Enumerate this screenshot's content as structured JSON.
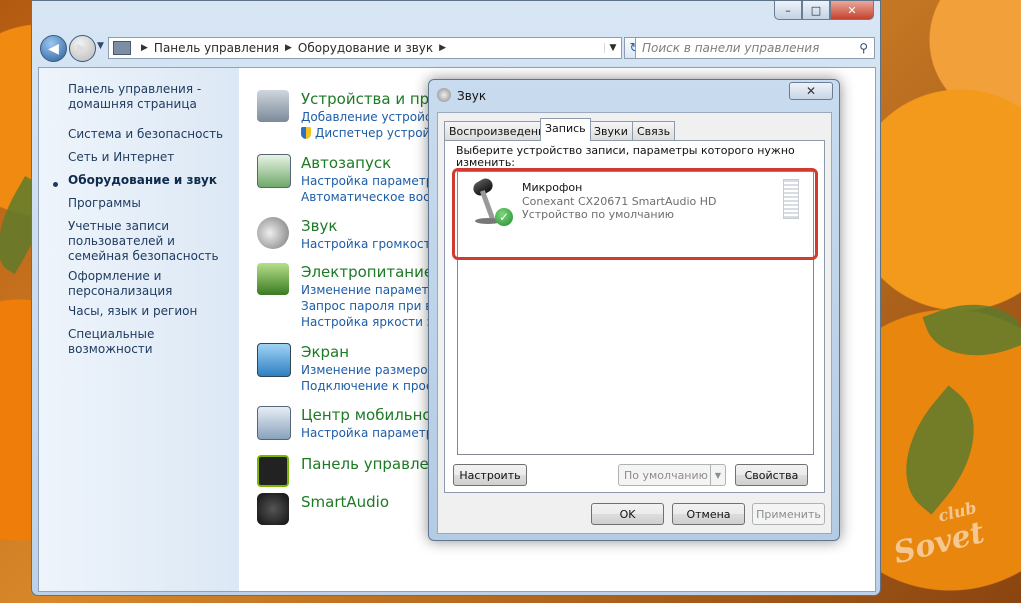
{
  "window": {
    "controls": {
      "minimize": "–",
      "maximize": "□",
      "close": "✕"
    }
  },
  "address": {
    "crumbs": [
      "Панель управления",
      "Оборудование и звук"
    ],
    "search_placeholder": "Поиск в панели управления"
  },
  "left_pane": {
    "items": [
      "Панель управления - домашняя страница",
      "Система и безопасность",
      "Сеть и Интернет",
      "Оборудование и звук",
      "Программы",
      "Учетные записи пользователей и семейная безопасность",
      "Оформление и персонализация",
      "Часы, язык и регион",
      "Специальные возможности"
    ],
    "active_index": 3
  },
  "categories": [
    {
      "title": "Устройства и принтеры",
      "icon": "devices-printers-icon",
      "links": [
        "Добавление устройства",
        "Диспетчер устройств"
      ]
    },
    {
      "title": "Автозапуск",
      "icon": "autoplay-icon",
      "links": [
        "Настройка параметров",
        "Автоматическое воспроизведение"
      ]
    },
    {
      "title": "Звук",
      "icon": "speaker-icon",
      "links": [
        "Настройка громкости"
      ]
    },
    {
      "title": "Электропитание",
      "icon": "power-options-icon",
      "links": [
        "Изменение параметров",
        "Запрос пароля при выходе",
        "Настройка яркости экрана"
      ]
    },
    {
      "title": "Экран",
      "icon": "display-icon",
      "links": [
        "Изменение размеров текста",
        "Подключение к проектору"
      ]
    },
    {
      "title": "Центр мобильности",
      "icon": "mobility-center-icon",
      "links": [
        "Настройка параметров"
      ]
    },
    {
      "title": "Панель управления",
      "icon": "nvidia-icon",
      "links": []
    },
    {
      "title": "SmartAudio",
      "icon": "smartaudio-icon",
      "links": []
    }
  ],
  "dialog": {
    "title": "Звук",
    "close": "✕",
    "tabs": [
      "Воспроизведение",
      "Запись",
      "Звуки",
      "Связь"
    ],
    "selected_tab": 1,
    "instruction": "Выберите устройство записи, параметры которого нужно изменить:",
    "device": {
      "name": "Микрофон",
      "description": "Conexant CX20671 SmartAudio HD",
      "status": "Устройство по умолчанию",
      "icon": "microphone-icon",
      "badge_icon": "green-check-icon"
    },
    "buttons": {
      "configure": "Настроить",
      "set_default": "По умолчанию",
      "properties": "Свойства",
      "ok": "OK",
      "cancel": "Отмена",
      "apply": "Применить"
    }
  },
  "watermark": {
    "line1": "Sovet",
    "line2": "club"
  },
  "colors": {
    "link": "#1d5da8",
    "category_title": "#1d7a25",
    "highlight_frame": "#d23a2e"
  }
}
